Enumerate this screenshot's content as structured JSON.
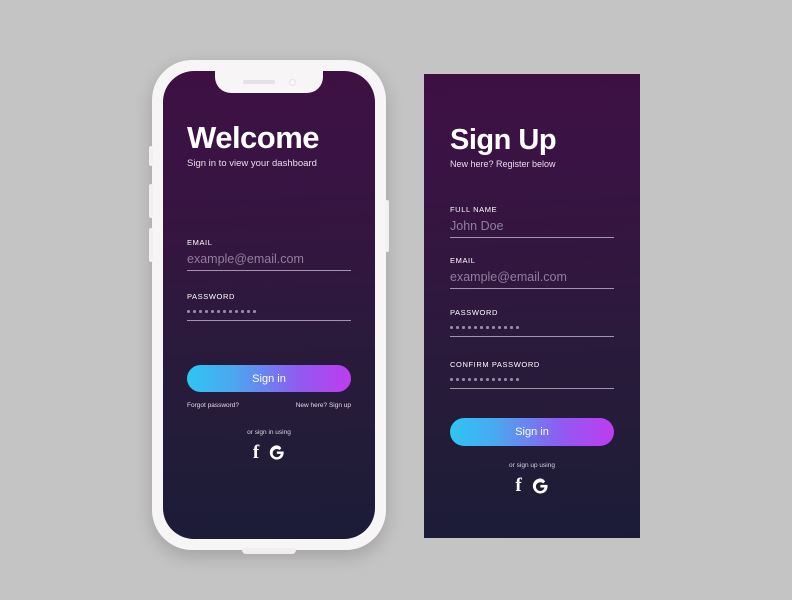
{
  "theme": {
    "page_background": "#c4c4c4",
    "card_gradient_top": "#3e1042",
    "card_gradient_bottom": "#1b1b38",
    "button_gradient_start": "#2fc5f2",
    "button_gradient_end": "#bf3cf0",
    "frame_color": "#f7f5f5"
  },
  "phone": {
    "title": "Welcome",
    "subtitle": "Sign in to view your dashboard",
    "fields": [
      {
        "label": "EMAIL",
        "value": "example@email.com",
        "type": "text"
      },
      {
        "label": "PASSWORD",
        "value": "",
        "type": "password",
        "dots": 12
      }
    ],
    "submit_label": "Sign in",
    "forgot_label": "Forgot password?",
    "signup_prefix": "New here?",
    "signup_link": "Sign up",
    "or_text": "or sign in using",
    "social": [
      {
        "name": "facebook-icon",
        "glyph": "f"
      },
      {
        "name": "google-icon",
        "glyph": "G"
      }
    ]
  },
  "panel": {
    "title": "Sign Up",
    "subtitle": "New here? Register below",
    "fields": [
      {
        "label": "FULL NAME",
        "value": "John Doe",
        "type": "text"
      },
      {
        "label": "EMAIL",
        "value": "example@email.com",
        "type": "text"
      },
      {
        "label": "PASSWORD",
        "value": "",
        "type": "password",
        "dots": 12
      },
      {
        "label": "CONFIRM PASSWORD",
        "value": "",
        "type": "password",
        "dots": 12
      }
    ],
    "submit_label": "Sign in",
    "or_text": "or sign up using",
    "social": [
      {
        "name": "facebook-icon",
        "glyph": "f"
      },
      {
        "name": "google-icon",
        "glyph": "G"
      }
    ]
  }
}
